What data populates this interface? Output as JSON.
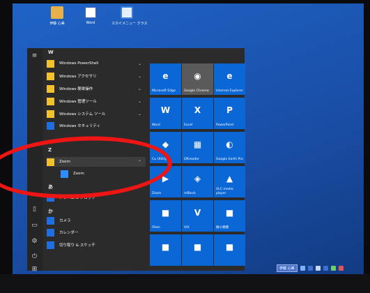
{
  "desktop": {
    "icons": [
      {
        "label": "伊藤 心美",
        "icon": "user-folder-icon"
      },
      {
        "label": "Word",
        "icon": "word-icon"
      },
      {
        "label": "スカイメニュー クラス",
        "icon": "skymenu-icon"
      }
    ]
  },
  "start_menu": {
    "rail": [
      {
        "icon": "hamburger-menu-icon",
        "glyph": "≡"
      },
      {
        "icon": "document-icon",
        "glyph": "▯"
      },
      {
        "icon": "pictures-icon",
        "glyph": "▭"
      },
      {
        "icon": "settings-gear-icon",
        "glyph": "⚙"
      },
      {
        "icon": "power-icon",
        "glyph": "⏻"
      },
      {
        "icon": "start-windows-icon",
        "glyph": "⊞"
      }
    ],
    "sections": {
      "w": "W",
      "z": "Z",
      "jp1": "あ",
      "jp2": "か"
    },
    "apps_w": [
      {
        "label": "Windows PowerShell",
        "chevron": "⌄"
      },
      {
        "label": "Windows アクセサリ",
        "chevron": "⌄"
      },
      {
        "label": "Windows 簡単操作",
        "chevron": "⌄"
      },
      {
        "label": "Windows 管理ツール",
        "chevron": "⌄"
      },
      {
        "label": "Windows システム ツール",
        "chevron": "⌄"
      },
      {
        "label": "Windows セキュリティ",
        "chevron": ""
      }
    ],
    "zoom_folder": {
      "label": "Zoom",
      "chevron": "⌃"
    },
    "zoom_app": {
      "label": "Zoom"
    },
    "apps_jp": [
      {
        "label": "アラーム & クロック"
      },
      {
        "label": "カメラ"
      },
      {
        "label": "カレンダー"
      },
      {
        "label": "切り取り & スケッチ"
      }
    ]
  },
  "tiles": [
    {
      "label": "Microsoft Edge",
      "icon": "edge-icon",
      "color": "#0b66d6"
    },
    {
      "label": "Google Chrome",
      "icon": "chrome-icon",
      "color": "#5a5a5a"
    },
    {
      "label": "Internet Explorer",
      "icon": "ie-icon",
      "color": "#0b66d6"
    },
    {
      "label": "Word",
      "icon": "word-icon",
      "color": "#0b66d6"
    },
    {
      "label": "Excel",
      "icon": "excel-icon",
      "color": "#0b66d6"
    },
    {
      "label": "PowerPoint",
      "icon": "powerpoint-icon",
      "color": "#0b66d6"
    },
    {
      "label": "Cu    Utility",
      "icon": "utility-icon",
      "color": "#0b66d6"
    },
    {
      "label": "QRreader",
      "icon": "qr-icon",
      "color": "#0b66d6"
    },
    {
      "label": "Google Earth Pro",
      "icon": "earth-icon",
      "color": "#0b66d6"
    },
    {
      "label": "Zoom",
      "icon": "zoom-icon",
      "color": "#0b66d6"
    },
    {
      "label": "mBlock",
      "icon": "mblock-icon",
      "color": "#0b66d6"
    },
    {
      "label": "VLC media player",
      "icon": "vlc-icon",
      "color": "#0b66d6"
    },
    {
      "label": "ITeen",
      "icon": "app-icon",
      "color": "#0b66d6"
    },
    {
      "label": "VIX",
      "icon": "vix-icon",
      "color": "#0b66d6"
    },
    {
      "label": "緑小教務",
      "icon": "app-icon",
      "color": "#0b66d6"
    },
    {
      "label": "",
      "icon": "app-icon",
      "color": "#0b66d6"
    },
    {
      "label": "",
      "icon": "app-icon",
      "color": "#0b66d6"
    },
    {
      "label": "",
      "icon": "app-icon",
      "color": "#0b66d6"
    }
  ],
  "taskbar": {
    "user_label": "伊藤 心美",
    "icons": [
      "network-icon",
      "app-icon",
      "app-icon",
      "app-icon",
      "app-icon",
      "app-icon"
    ]
  },
  "colors": {
    "annotation": "#ee1515",
    "tile": "#0b66d6",
    "folder": "#f2c12e"
  }
}
